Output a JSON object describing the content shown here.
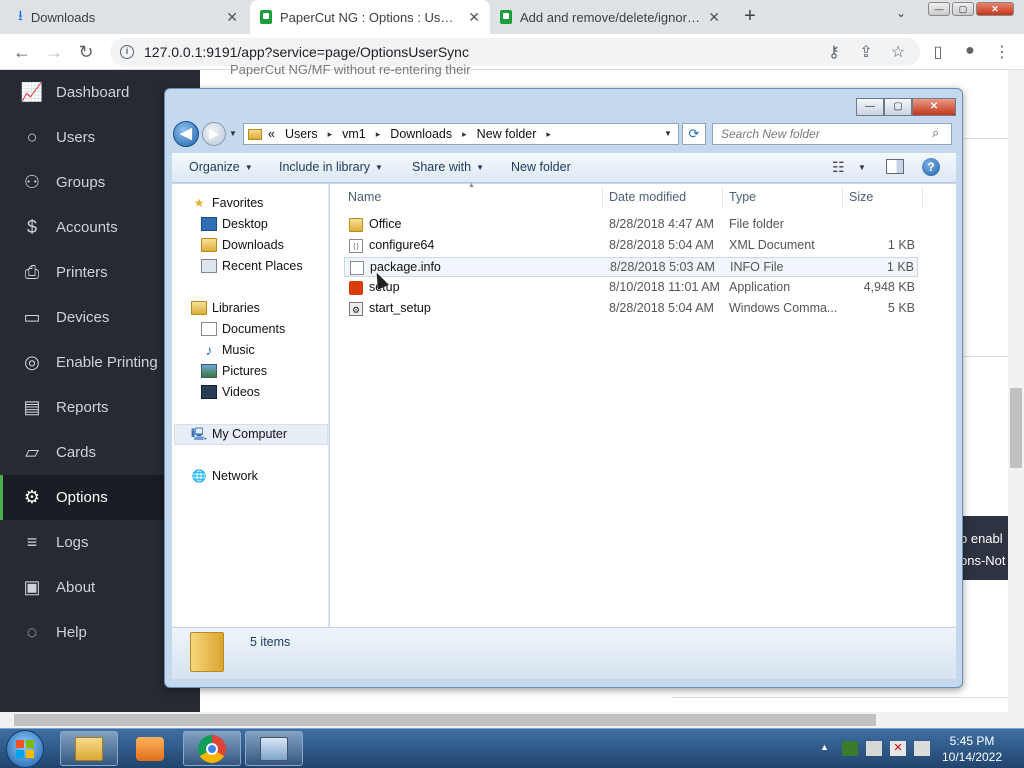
{
  "browser": {
    "tabs": [
      {
        "title": "Downloads",
        "close": "✕"
      },
      {
        "title": "PaperCut NG : Options : User/Gr",
        "close": "✕"
      },
      {
        "title": "Add and remove/delete/ignore p",
        "close": "✕"
      }
    ],
    "new_tab": "+",
    "tab_dropdown": "⌄",
    "window_controls": {
      "minimize": "—",
      "maximize": "▢",
      "close": "✕"
    },
    "address": "127.0.0.1:9191/app?service=page/OptionsUserSync",
    "nav": {
      "back": "←",
      "forward": "→",
      "reload": "↻"
    },
    "actions": {
      "key": "⚷",
      "share": "⇪",
      "star": "☆",
      "sidepanel": "▯",
      "profile": "●",
      "menu": "⋮"
    }
  },
  "sidebar": {
    "items": [
      {
        "label": "Dashboard",
        "icon": "📈"
      },
      {
        "label": "Users",
        "icon": "○"
      },
      {
        "label": "Groups",
        "icon": "⚇"
      },
      {
        "label": "Accounts",
        "icon": "$"
      },
      {
        "label": "Printers",
        "icon": "⎙"
      },
      {
        "label": "Devices",
        "icon": "▭"
      },
      {
        "label": "Enable Printing",
        "icon": "◎"
      },
      {
        "label": "Reports",
        "icon": "▤"
      },
      {
        "label": "Cards",
        "icon": "▱"
      },
      {
        "label": "Options",
        "icon": "⚙"
      },
      {
        "label": "Logs",
        "icon": "≡"
      },
      {
        "label": "About",
        "icon": "▣"
      },
      {
        "label": "Help",
        "icon": "◌"
      }
    ],
    "active": "Options"
  },
  "background_page": {
    "partial_text": "PaperCut NG/MF without re-entering their",
    "banner_text_1": "o enabl",
    "banner_text_2": "ons-Not"
  },
  "explorer": {
    "window_controls": {
      "minimize": "—",
      "maximize": "▢",
      "close": "✕"
    },
    "nav": {
      "back": "◀",
      "forward": "▶",
      "dropdown": "▼",
      "refresh": "⟳"
    },
    "breadcrumb": [
      "Users",
      "vm1",
      "Downloads",
      "New folder"
    ],
    "breadcrumb_prefix": "«",
    "breadcrumb_sep": "▸",
    "search_placeholder": "Search New folder",
    "search_icon": "⌕",
    "commands": {
      "organize": "Organize",
      "include_in_library": "Include in library",
      "share_with": "Share with",
      "new_folder": "New folder",
      "dropdown": "▼",
      "views": "☷",
      "help": "?"
    },
    "nav_pane": {
      "favorites": {
        "label": "Favorites",
        "icon": "★",
        "items": [
          "Desktop",
          "Downloads",
          "Recent Places"
        ]
      },
      "libraries": {
        "label": "Libraries",
        "icon": "▤",
        "items": [
          "Documents",
          "Music",
          "Pictures",
          "Videos"
        ]
      },
      "computer": {
        "label": "My Computer",
        "icon": "🖳"
      },
      "network": {
        "label": "Network",
        "icon": "🌐"
      }
    },
    "columns": {
      "name": "Name",
      "date": "Date modified",
      "type": "Type",
      "size": "Size",
      "sort": "▲"
    },
    "files": [
      {
        "name": "Office",
        "date": "8/28/2018 4:47 AM",
        "type": "File folder",
        "size": "",
        "icon": "folder"
      },
      {
        "name": "configure64",
        "date": "8/28/2018 5:04 AM",
        "type": "XML Document",
        "size": "1 KB",
        "icon": "doc"
      },
      {
        "name": "package.info",
        "date": "8/28/2018 5:03 AM",
        "type": "INFO File",
        "size": "1 KB",
        "icon": "doc"
      },
      {
        "name": "setup",
        "date": "8/10/2018 11:01 AM",
        "type": "Application",
        "size": "4,948 KB",
        "icon": "office"
      },
      {
        "name": "start_setup",
        "date": "8/28/2018 5:04 AM",
        "type": "Windows Comma...",
        "size": "5 KB",
        "icon": "cmd"
      }
    ],
    "status": "5 items"
  },
  "taskbar": {
    "tray_arrow": "▲",
    "clock_time": "5:45 PM",
    "clock_date": "10/14/2022"
  },
  "colors": {
    "sidebar_bg": "#262a33",
    "active_accent": "#4caf50",
    "explorer_frame": "#c4d8ee",
    "taskbar": "#21446e"
  }
}
